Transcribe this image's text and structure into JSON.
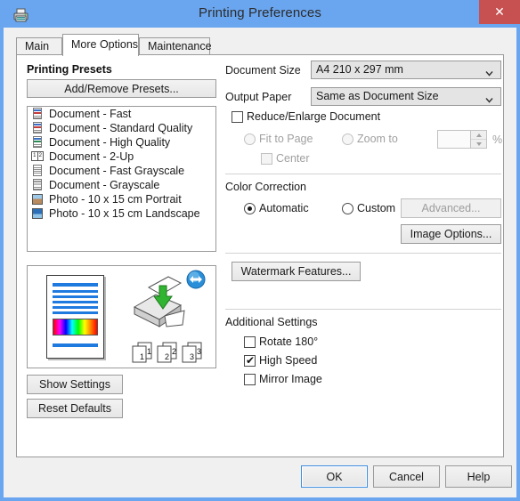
{
  "window": {
    "title": "Printing Preferences",
    "icon": "printer-icon",
    "close_label": "✕",
    "titlebar_color": "#6aa6f0",
    "close_color": "#c75050"
  },
  "tabs": [
    {
      "label": "Main",
      "active": false
    },
    {
      "label": "More Options",
      "active": true
    },
    {
      "label": "Maintenance",
      "active": false
    }
  ],
  "left": {
    "presets_heading": "Printing Presets",
    "add_remove_label": "Add/Remove Presets...",
    "presets": [
      {
        "label": "Document - Fast",
        "icon": "document-fast-icon"
      },
      {
        "label": "Document - Standard Quality",
        "icon": "document-standard-icon"
      },
      {
        "label": "Document - High Quality",
        "icon": "document-high-icon"
      },
      {
        "label": "Document - 2-Up",
        "icon": "document-2up-icon"
      },
      {
        "label": "Document - Fast Grayscale",
        "icon": "document-fast-grayscale-icon"
      },
      {
        "label": "Document - Grayscale",
        "icon": "document-grayscale-icon"
      },
      {
        "label": "Photo - 10 x 15 cm Portrait",
        "icon": "photo-portrait-icon"
      },
      {
        "label": "Photo - 10 x 15 cm Landscape",
        "icon": "photo-landscape-icon"
      }
    ],
    "preview": {
      "page_numbers": [
        "1",
        "2",
        "3"
      ],
      "badge": "duplex-badge-icon",
      "printer": "printer-illustration"
    },
    "show_settings_label": "Show Settings",
    "reset_defaults_label": "Reset Defaults"
  },
  "right": {
    "document_size_label": "Document Size",
    "document_size_value": "A4 210 x 297 mm",
    "output_paper_label": "Output Paper",
    "output_paper_value": "Same as Document Size",
    "reduce_enlarge_label": "Reduce/Enlarge Document",
    "reduce_enlarge_checked": false,
    "fit_to_page_label": "Fit to Page",
    "fit_to_page_selected": false,
    "zoom_to_label": "Zoom to",
    "zoom_to_selected": false,
    "zoom_value": "",
    "percent_label": "%",
    "center_label": "Center",
    "center_checked": false,
    "color_correction_label": "Color Correction",
    "automatic_label": "Automatic",
    "automatic_selected": true,
    "custom_label": "Custom",
    "custom_selected": false,
    "advanced_label": "Advanced...",
    "advanced_enabled": false,
    "image_options_label": "Image Options...",
    "watermark_label": "Watermark Features...",
    "additional_settings_label": "Additional Settings",
    "rotate_label": "Rotate 180°",
    "rotate_checked": false,
    "high_speed_label": "High Speed",
    "high_speed_checked": true,
    "mirror_label": "Mirror Image",
    "mirror_checked": false
  },
  "footer": {
    "ok_label": "OK",
    "cancel_label": "Cancel",
    "help_label": "Help"
  }
}
